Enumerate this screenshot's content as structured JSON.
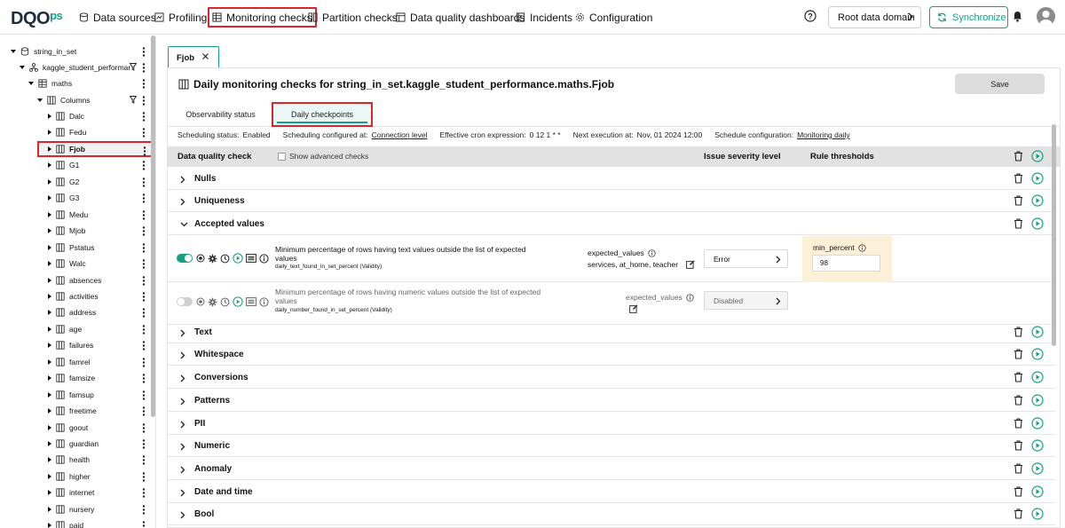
{
  "header": {
    "logo_main": "DQO",
    "logo_suffix": "ps",
    "nav": [
      {
        "label": "Data sources",
        "icon": "database-icon"
      },
      {
        "label": "Profiling",
        "icon": "profiling-icon"
      },
      {
        "label": "Monitoring checks",
        "icon": "table-icon"
      },
      {
        "label": "Partition checks",
        "icon": "partition-icon"
      },
      {
        "label": "Data quality dashboards",
        "icon": "dashboard-icon"
      },
      {
        "label": "Incidents",
        "icon": "incidents-icon"
      },
      {
        "label": "Configuration",
        "icon": "gear-icon"
      }
    ],
    "active_nav": "Monitoring checks",
    "domain_label": "Root data domain",
    "sync_label": "Synchronize"
  },
  "sidebar": {
    "connection": "string_in_set",
    "schema": "kaggle_student_performar",
    "table": "maths",
    "columns_label": "Columns",
    "selected": "Fjob",
    "columns": [
      "Dalc",
      "Fedu",
      "Fjob",
      "G1",
      "G2",
      "G3",
      "Medu",
      "Mjob",
      "Pstatus",
      "Walc",
      "absences",
      "activities",
      "address",
      "age",
      "failures",
      "famrel",
      "famsize",
      "famsup",
      "freetime",
      "goout",
      "guardian",
      "health",
      "higher",
      "internet",
      "nursery",
      "paid"
    ]
  },
  "tab": {
    "label": "Fjob"
  },
  "page": {
    "title": "Daily monitoring checks for string_in_set.kaggle_student_performance.maths.Fjob",
    "save_label": "Save",
    "subtabs": [
      "Observability status",
      "Daily checkpoints"
    ],
    "active_subtab": "Daily checkpoints"
  },
  "schedule": {
    "status_label": "Scheduling status:",
    "status_value": "Enabled",
    "configured_label": "Scheduling configured at:",
    "configured_value": "Connection level",
    "cron_label": "Effective cron expression:",
    "cron_value": "0 12 1 * *",
    "next_label": "Next execution at:",
    "next_value": "Nov, 01 2024 12:00",
    "config_label": "Schedule configuration:",
    "config_value": "Monitoring daily"
  },
  "table_header": {
    "check": "Data quality check",
    "advanced": "Show advanced checks",
    "severity": "Issue severity level",
    "thresholds": "Rule thresholds"
  },
  "categories": [
    "Nulls",
    "Uniqueness",
    "Accepted values",
    "Text",
    "Whitespace",
    "Conversions",
    "Patterns",
    "PII",
    "Numeric",
    "Anomaly",
    "Date and time",
    "Bool"
  ],
  "checks": [
    {
      "enabled": true,
      "title": "Minimum percentage of rows having text values outside the list of expected values",
      "name": "daily_text_found_in_set_percent (Validity)",
      "param_label": "expected_values",
      "param_value": "services, at_home, teacher",
      "severity": "Error",
      "rule_label": "min_percent",
      "rule_value": "98"
    },
    {
      "enabled": false,
      "title": "Minimum percentage of rows having numeric values outside the list of expected values",
      "name": "daily_number_found_in_set_percent (Validity)",
      "param_label": "expected_values",
      "severity": "Disabled"
    }
  ],
  "colors": {
    "accent": "#14a085",
    "highlight": "#d9262c",
    "rule_bg": "#fdf0d8"
  }
}
